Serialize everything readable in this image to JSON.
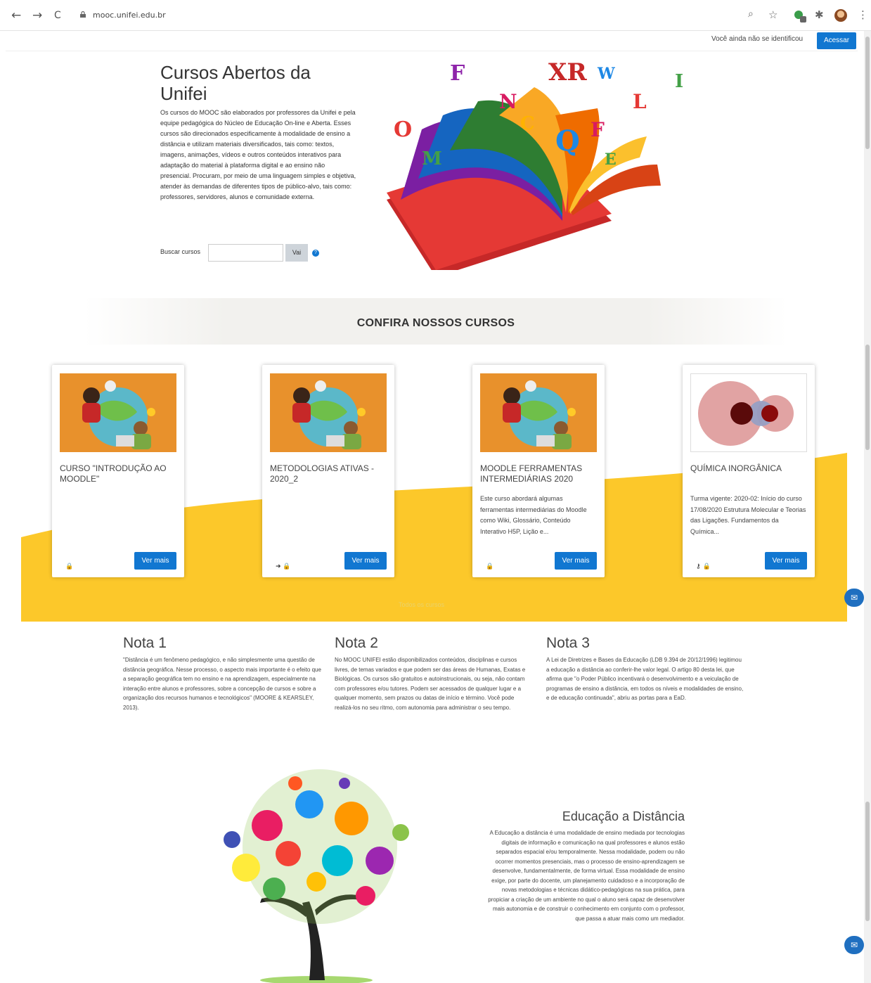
{
  "browser": {
    "url": "mooc.unifei.edu.br",
    "back_icon": "←",
    "forward_icon": "→",
    "reload_icon": "C",
    "zoom_icon": "⌕",
    "star_icon": "☆",
    "puzzle_icon": "✱",
    "menu_icon": "⋮"
  },
  "header": {
    "login_note": "Você ainda não se identificou",
    "login_button": "Acessar"
  },
  "hero": {
    "title": "Cursos Abertos da Unifei",
    "description": "Os cursos do MOOC são elaborados por professores da Unifei e pela equipe pedagógica do Núcleo de Educação On-line e Aberta. Esses cursos são direcionados especificamente à modalidade de ensino a distância e utilizam materiais diversificados, tais como: textos, imagens, animações, vídeos e outros conteúdos interativos para adaptação do material à plataforma digital e ao ensino não presencial. Procuram, por meio de uma linguagem simples e objetiva, atender às demandas de diferentes tipos de público-alvo, tais como: professores, servidores, alunos e comunidade externa.",
    "search_label": "Buscar cursos",
    "search_placeholder": "",
    "search_button": "Vai",
    "help_icon": "?"
  },
  "banner": {
    "title": "CONFIRA NOSSOS CURSOS"
  },
  "courses": [
    {
      "title": "CURSO \"INTRODUÇÃO AO MOODLE\"",
      "description": "",
      "icons": "🔒",
      "button": "Ver mais"
    },
    {
      "title": "METODOLOGIAS ATIVAS - 2020_2",
      "description": "",
      "icons": "➜ 🔒",
      "button": "Ver mais"
    },
    {
      "title": "MOODLE FERRAMENTAS INTERMEDIÁRIAS 2020",
      "description": "Este curso abordará algumas ferramentas intermediárias do Moodle como Wiki, Glossário, Conteúdo Interativo H5P, Lição e...",
      "icons": "🔒",
      "button": "Ver mais"
    },
    {
      "title": "QUÍMICA INORGÂNICA",
      "description": "Turma vigente: 2020-02: Início do curso 17/08/2020 Estrutura Molecular e Teorias das Ligações. Fundamentos da Química...",
      "icons": "⚷ 🔒",
      "button": "Ver mais"
    }
  ],
  "all_courses_link": "Todos os cursos",
  "notes": [
    {
      "title": "Nota 1",
      "text": "\"Distância é um fenômeno pedagógico, e não simplesmente uma questão de distância geográfica. Nesse processo, o aspecto mais importante é o efeito que a separação geográfica tem no ensino e na aprendizagem, especialmente na interação entre alunos e professores, sobre a concepção de cursos e sobre a organização dos recursos humanos e tecnológicos\" (MOORE & KEARSLEY, 2013)."
    },
    {
      "title": "Nota 2",
      "text": "No MOOC UNIFEI estão disponibilizados conteúdos, disciplinas e cursos livres, de temas variados e que podem ser das áreas de Humanas, Exatas e Biológicas. Os cursos são gratuitos e autoinstrucionais, ou seja, não contam com professores e/ou tutores. Podem ser acessados de qualquer lugar e a qualquer momento, sem prazos ou datas de início e término. Você pode realizá-los no seu ritmo, com autonomia para administrar o seu tempo."
    },
    {
      "title": "Nota 3",
      "text": "A Lei de Diretrizes e Bases da Educação (LDB 9.394 de 20/12/1996) legitimou a educação a distância ao conferir-lhe valor legal. O artigo 80 desta lei, que afirma que \"o Poder Público incentivará o desenvolvimento e a veiculação de programas de ensino a distância, em todos os níveis e modalidades de ensino, e de educação continuada\", abriu as portas para a EaD."
    }
  ],
  "ead": {
    "title": "Educação a Distância",
    "text": "A Educação a distância é uma modalidade de ensino mediada por tecnologias digitais de informação e comunicação na qual professores e alunos estão separados espacial e/ou temporalmente. Nessa modalidade, podem ou não ocorrer momentos presenciais, mas o processo de ensino-aprendizagem se desenvolve, fundamentalmente, de forma virtual. Essa modalidade de ensino exige, por parte do docente, um planejamento cuidadoso e a incorporação de novas metodologias e técnicas didático-pedagógicas na sua prática, para propiciar a criação de um ambiente no qual o aluno será capaz de desenvolver mais autonomia e de construir o conhecimento em conjunto com o professor, que passa a atuar mais como um mediador."
  },
  "chat_icon": "✉",
  "colors": {
    "accent": "#1177d1",
    "yellow": "#fcc82a",
    "orange": "#e8912c"
  }
}
